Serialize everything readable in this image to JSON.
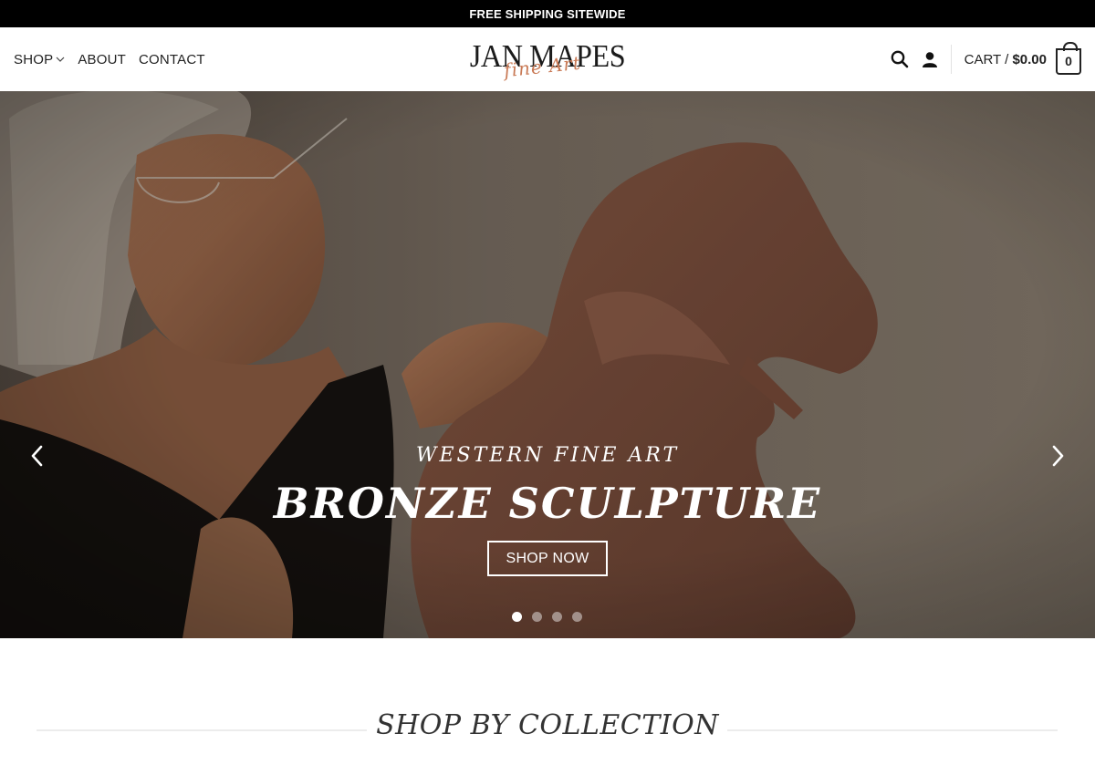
{
  "topbar": {
    "text": "FREE SHIPPING SITEWIDE"
  },
  "nav": {
    "shop": "SHOP",
    "about": "ABOUT",
    "contact": "CONTACT"
  },
  "logo": {
    "name": "JAN MAPES",
    "script": "fine Art"
  },
  "header_right": {
    "search_icon": "search-icon",
    "account_icon": "user-icon",
    "cart_label": "CART /",
    "cart_total": "$0.00",
    "cart_count": "0"
  },
  "hero": {
    "subtitle": "WESTERN FINE ART",
    "title": "BRONZE SCULPTURE",
    "button": "SHOP NOW",
    "slides": 4,
    "active_slide": 1
  },
  "section": {
    "title": "SHOP BY COLLECTION"
  },
  "colors": {
    "topbar": "#000000",
    "accent_script": "#c97a56",
    "text": "#222222"
  }
}
